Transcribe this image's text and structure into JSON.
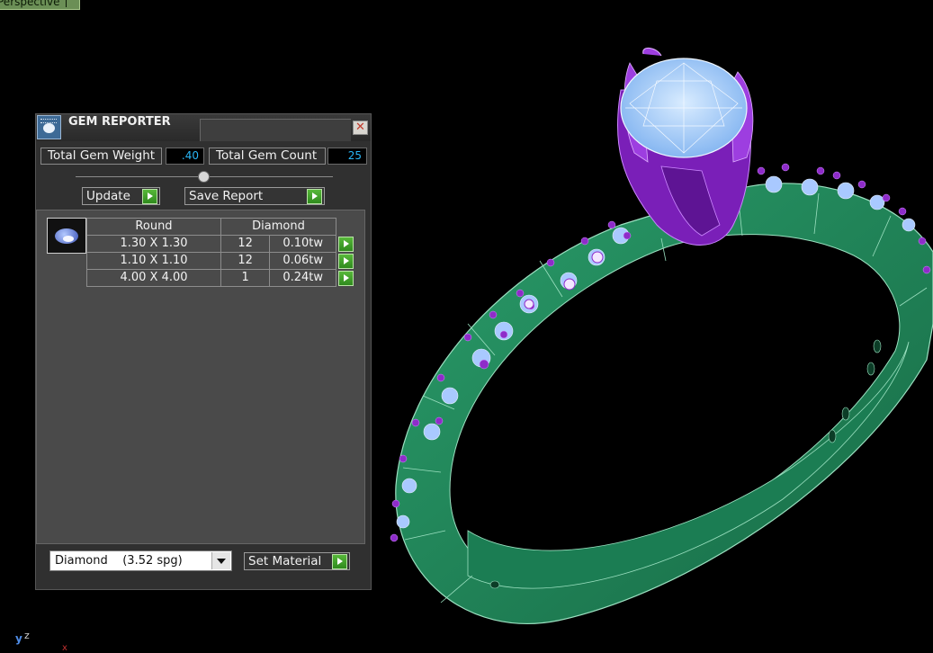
{
  "viewport": {
    "label": "Perspective"
  },
  "axis": {
    "y": "y",
    "z": "z",
    "x": "x"
  },
  "gem_reporter": {
    "title": "GEM REPORTER",
    "close_glyph": "✕",
    "total_gem_weight_label": "Total Gem Weight",
    "total_gem_weight_value": ".40",
    "total_gem_count_label": "Total Gem Count",
    "total_gem_count_value": "25",
    "update_label": "Update",
    "save_report_label": "Save Report",
    "table": {
      "headers": {
        "shape": "Round",
        "material": "Diamond"
      },
      "rows": [
        {
          "size": "1.30 X 1.30",
          "count": "12",
          "weight": "0.10tw"
        },
        {
          "size": "1.10 X 1.10",
          "count": "12",
          "weight": "0.06tw"
        },
        {
          "size": "4.00 X 4.00",
          "count": "1",
          "weight": "0.24tw"
        }
      ]
    },
    "material_select": "Diamond    (3.52 spg)",
    "set_material_label": "Set Material"
  },
  "colors": {
    "band": "#1f8a5c",
    "prongs": "#8a2be2",
    "center_stone": "#9fc8ff",
    "accent_go": "#3aa125",
    "value_text": "#29b6f6"
  },
  "icons": [
    "gem-reporter-icon",
    "close-icon",
    "play-arrow-icon",
    "dropdown-arrow-icon",
    "round-gem-icon"
  ]
}
